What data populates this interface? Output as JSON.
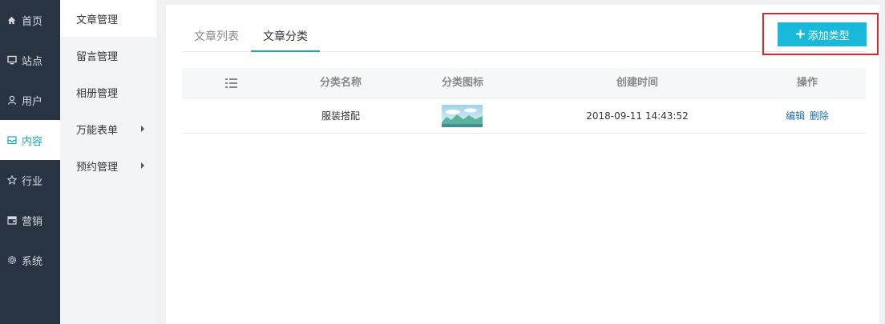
{
  "leftnav": {
    "items": [
      {
        "label": "首页",
        "icon": "home-icon"
      },
      {
        "label": "站点",
        "icon": "monitor-icon"
      },
      {
        "label": "用户",
        "icon": "user-icon"
      },
      {
        "label": "内容",
        "icon": "inbox-icon",
        "active": true
      },
      {
        "label": "行业",
        "icon": "star-icon"
      },
      {
        "label": "营销",
        "icon": "wallet-icon"
      },
      {
        "label": "系统",
        "icon": "gear-icon"
      }
    ]
  },
  "submenu": {
    "items": [
      {
        "label": "文章管理",
        "active": true
      },
      {
        "label": "留言管理"
      },
      {
        "label": "相册管理"
      },
      {
        "label": "万能表单",
        "has_caret": true
      },
      {
        "label": "预约管理",
        "has_caret": true
      }
    ]
  },
  "tabs": [
    {
      "label": "文章列表"
    },
    {
      "label": "文章分类",
      "active": true
    }
  ],
  "toolbar": {
    "add_label": "添加类型"
  },
  "table": {
    "headers": [
      "分类名称",
      "分类图标",
      "创建时间",
      "操作"
    ],
    "rows": [
      {
        "name": "服装搭配",
        "created": "2018-09-11 14:43:52",
        "edit": "编辑",
        "delete": "删除"
      }
    ]
  },
  "colors": {
    "accent": "#17b8d9",
    "nav_bg": "#293443",
    "highlight_border": "#e0262c",
    "link": "#1f6fb5"
  }
}
